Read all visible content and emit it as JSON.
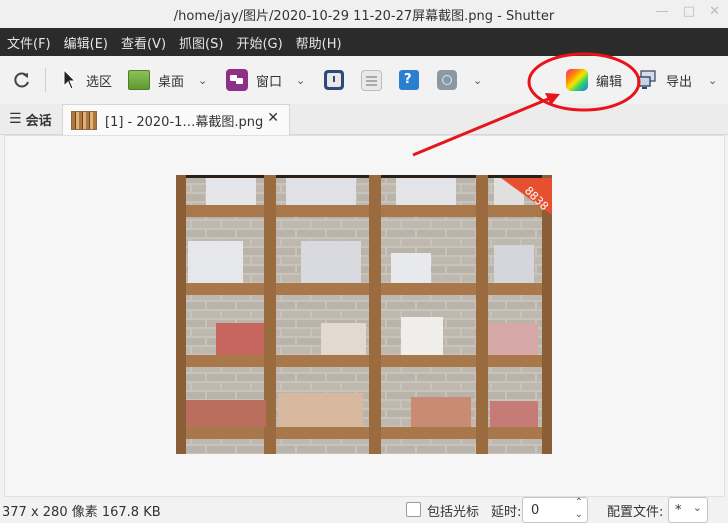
{
  "window": {
    "title": "/home/jay/图片/2020-10-29 11-20-27屏幕截图.png - Shutter"
  },
  "menu": [
    "文件(F)",
    "编辑(E)",
    "查看(V)",
    "抓图(S)",
    "开始(G)",
    "帮助(H)"
  ],
  "toolbar": {
    "select_label": "选区",
    "desktop_label": "桌面",
    "window_label": "窗口",
    "edit_label": "编辑",
    "export_label": "导出"
  },
  "tabs": {
    "session_label": "会话",
    "file_tab_label": "[1] - 2020-1…幕截图.png"
  },
  "image": {
    "badge_text": "8838"
  },
  "status": {
    "info": "377 x 280 像素  167.8 KB",
    "include_cursor_label": "包括光标",
    "delay_label": "延时:",
    "delay_value": "0",
    "profile_label": "配置文件:",
    "profile_value": "*"
  },
  "colors": {
    "menubar_bg": "#2b2b2b",
    "annotation_red": "#e8141b"
  }
}
